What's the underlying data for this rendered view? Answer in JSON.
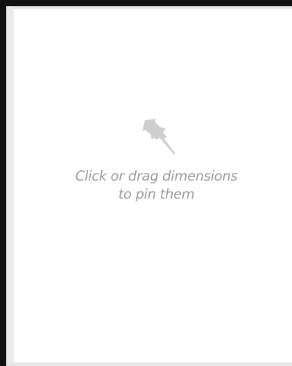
{
  "pin_panel": {
    "icon": "pushpin-icon",
    "icon_color": "#cfcfcf",
    "hint_line1": "Click or drag dimensions",
    "hint_line2": "to pin them",
    "hint_color": "#9a9a9a"
  }
}
